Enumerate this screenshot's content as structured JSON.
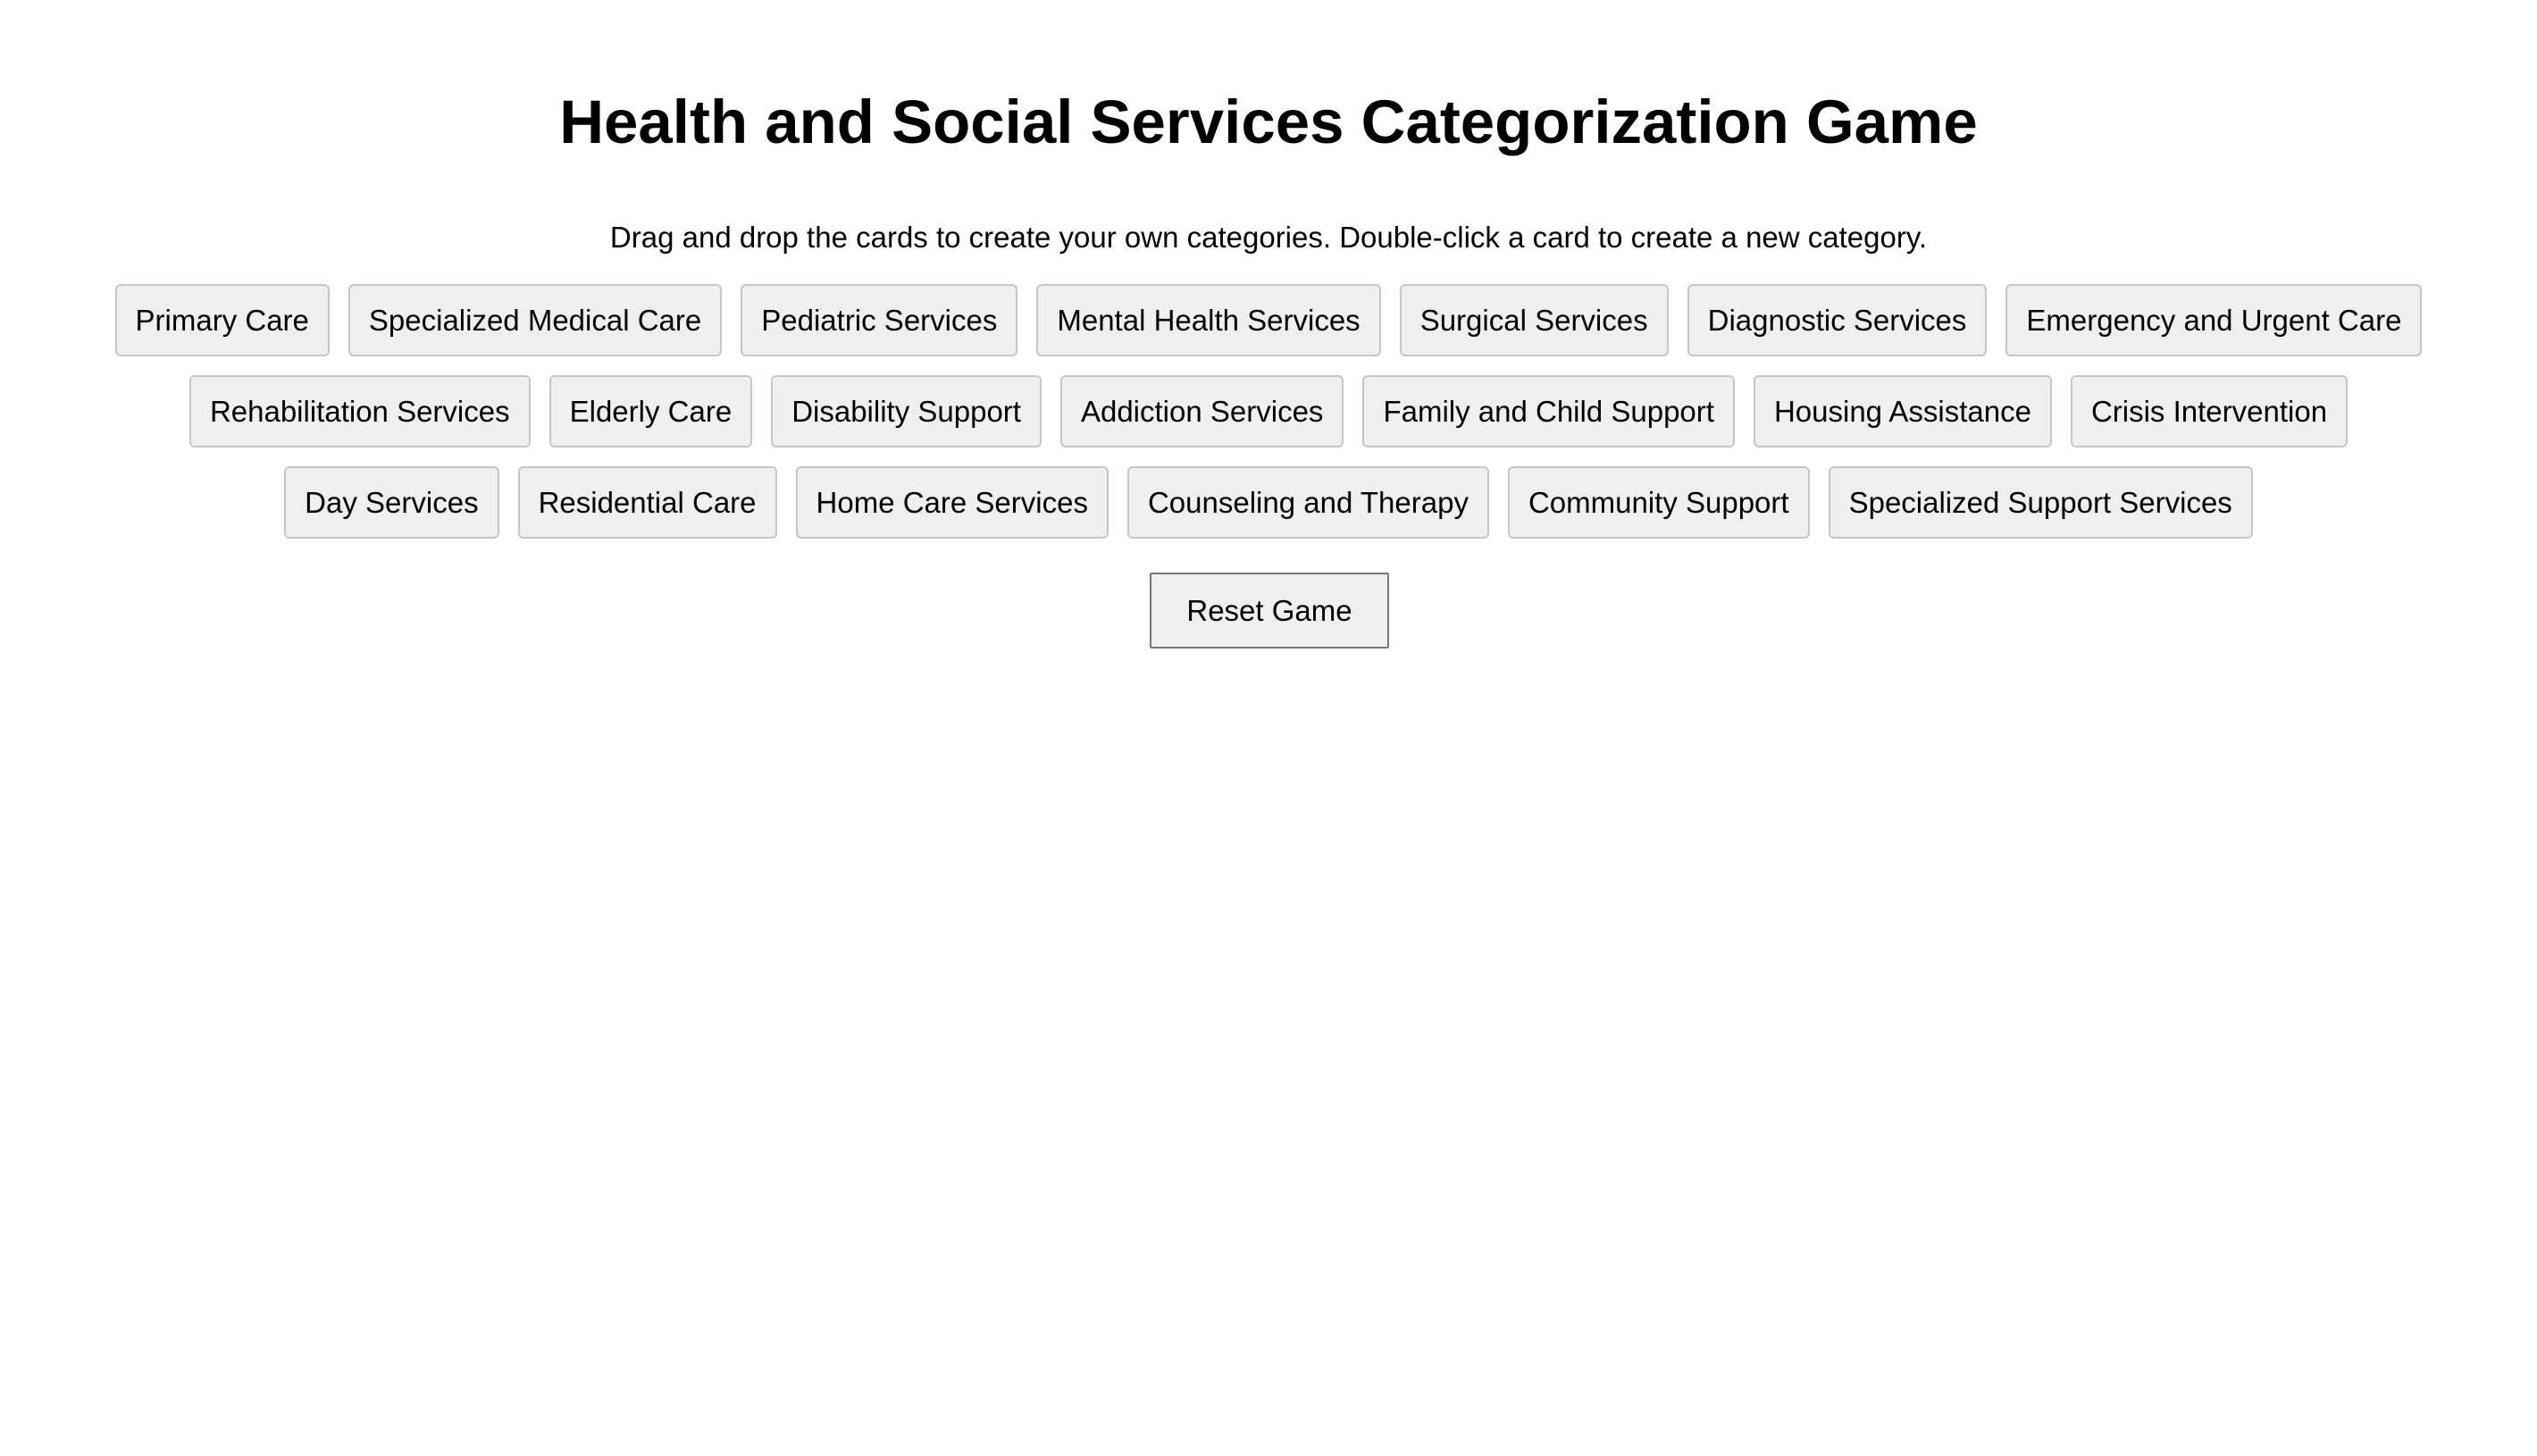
{
  "game": {
    "title": "Health and Social Services Categorization Game",
    "instructions": "Drag and drop the cards to create your own categories. Double-click a card to create a new category.",
    "cards": [
      "Primary Care",
      "Specialized Medical Care",
      "Pediatric Services",
      "Mental Health Services",
      "Surgical Services",
      "Diagnostic Services",
      "Emergency and Urgent Care",
      "Rehabilitation Services",
      "Elderly Care",
      "Disability Support",
      "Addiction Services",
      "Family and Child Support",
      "Housing Assistance",
      "Crisis Intervention",
      "Day Services",
      "Residential Care",
      "Home Care Services",
      "Counseling and Therapy",
      "Community Support",
      "Specialized Support Services"
    ],
    "reset_label": "Reset Game"
  },
  "colors": {
    "card_background": "#efefef",
    "card_border": "#c6c6c6",
    "button_border": "#767676",
    "page_background": "#ffffff",
    "text": "#000000"
  }
}
